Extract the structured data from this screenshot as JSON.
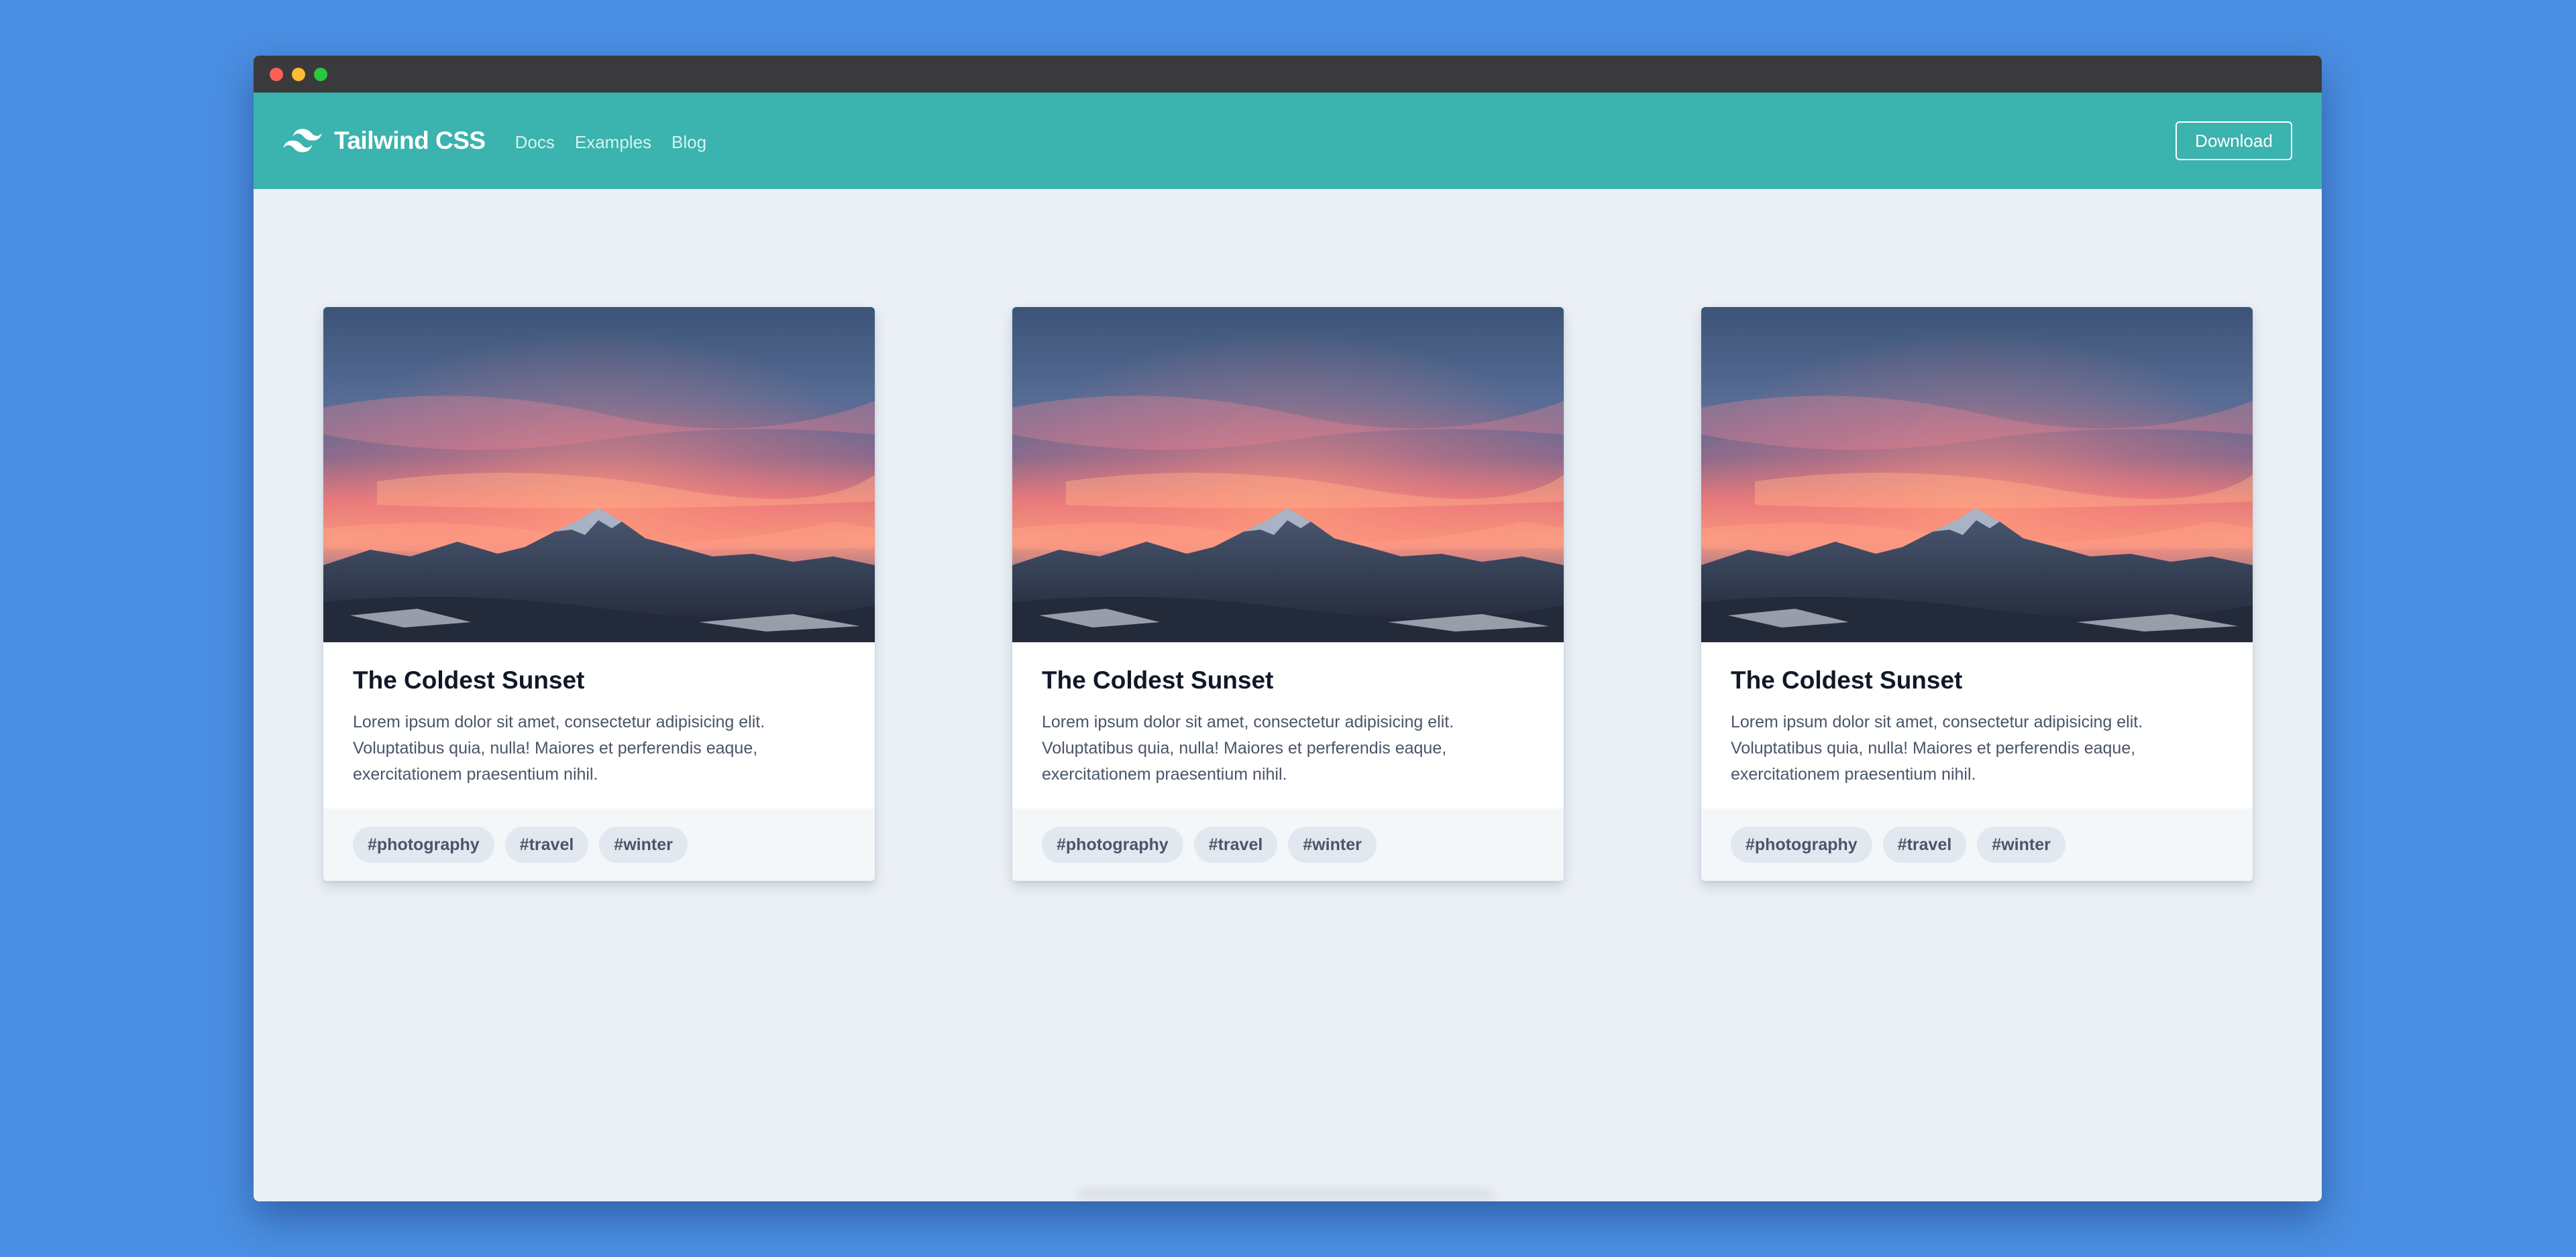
{
  "window": {
    "controls": [
      "close",
      "minimize",
      "maximize"
    ]
  },
  "navbar": {
    "background": "#3bb3ae",
    "logo_icon": "tailwind-logo-icon",
    "brand": "Tailwind CSS",
    "links": [
      "Docs",
      "Examples",
      "Blog"
    ],
    "download_label": "Download"
  },
  "cards": [
    {
      "image": "mountain-sunset-photo",
      "title": "The Coldest Sunset",
      "text": "Lorem ipsum dolor sit amet, consectetur adipisicing elit. Voluptatibus quia, nulla! Maiores et perferendis eaque, exercitationem praesentium nihil.",
      "tags": [
        "#photography",
        "#travel",
        "#winter"
      ]
    },
    {
      "image": "mountain-sunset-photo",
      "title": "The Coldest Sunset",
      "text": "Lorem ipsum dolor sit amet, consectetur adipisicing elit. Voluptatibus quia, nulla! Maiores et perferendis eaque, exercitationem praesentium nihil.",
      "tags": [
        "#photography",
        "#travel",
        "#winter"
      ]
    },
    {
      "image": "mountain-sunset-photo",
      "title": "The Coldest Sunset",
      "text": "Lorem ipsum dolor sit amet, consectetur adipisicing elit. Voluptatibus quia, nulla! Maiores et perferendis eaque, exercitationem praesentium nihil.",
      "tags": [
        "#photography",
        "#travel",
        "#winter"
      ]
    }
  ]
}
